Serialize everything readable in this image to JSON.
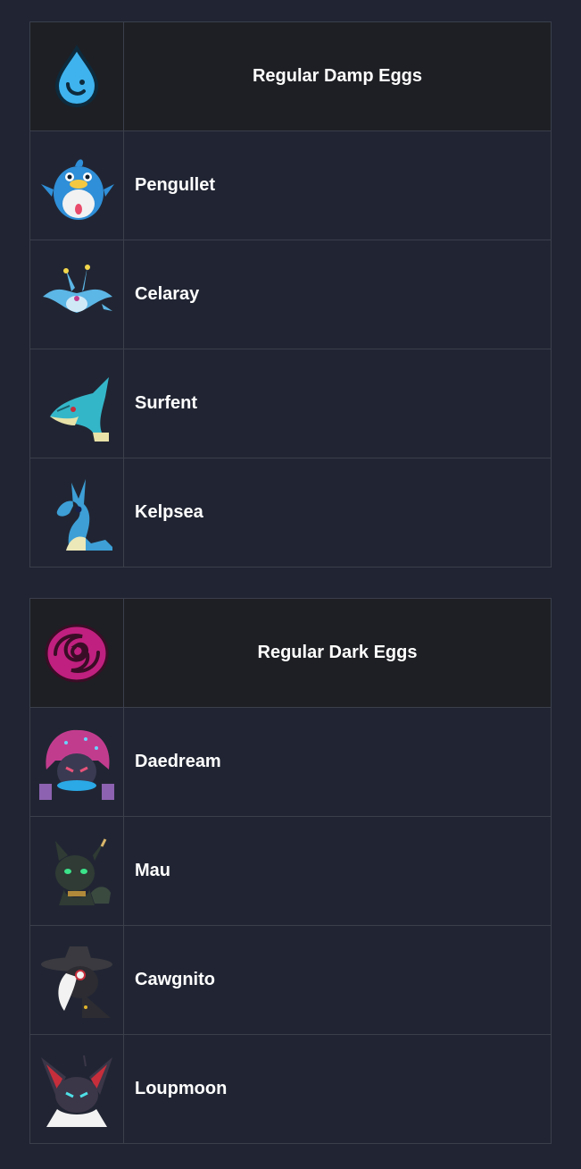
{
  "tables": [
    {
      "title": "Regular Damp Eggs",
      "element_icon": "water-drop-icon",
      "accent": "#3fb3ee",
      "rows": [
        {
          "name": "Pengullet",
          "icon": "pengullet-icon",
          "color": "#2f8fd8"
        },
        {
          "name": "Celaray",
          "icon": "celaray-icon",
          "color": "#5cb6e6"
        },
        {
          "name": "Surfent",
          "icon": "surfent-icon",
          "color": "#34b6c9"
        },
        {
          "name": "Kelpsea",
          "icon": "kelpsea-icon",
          "color": "#3d9fd6"
        }
      ]
    },
    {
      "title": "Regular Dark Eggs",
      "element_icon": "dark-swirl-icon",
      "accent": "#c0207f",
      "rows": [
        {
          "name": "Daedream",
          "icon": "daedream-icon",
          "color": "#c23c8e"
        },
        {
          "name": "Mau",
          "icon": "mau-icon",
          "color": "#2f3b34"
        },
        {
          "name": "Cawgnito",
          "icon": "cawgnito-icon",
          "color": "#3a3a40"
        },
        {
          "name": "Loupmoon",
          "icon": "loupmoon-icon",
          "color": "#3b3648"
        }
      ]
    }
  ]
}
